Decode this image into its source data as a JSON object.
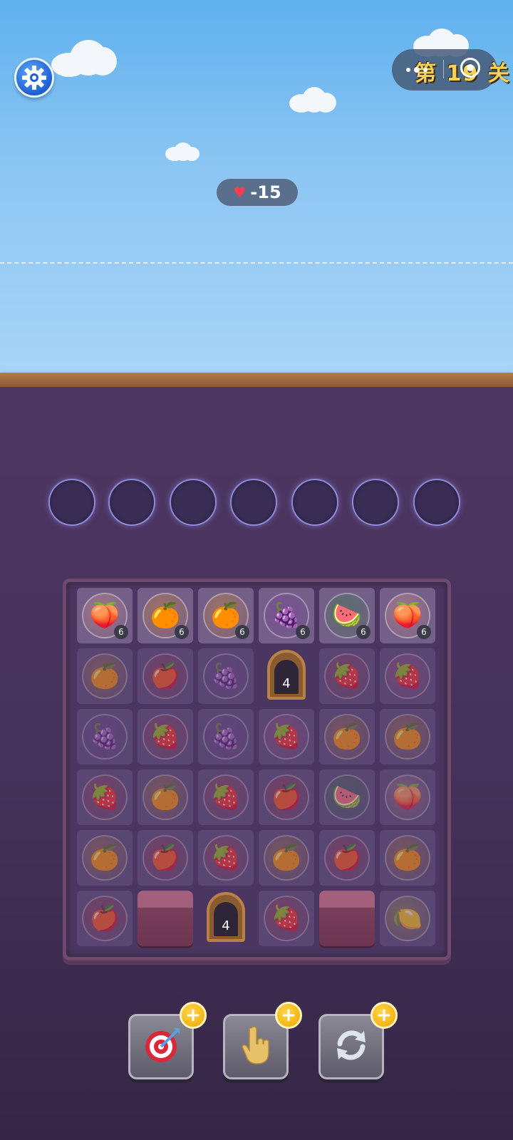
{
  "header": {
    "level_label": "第 19 关",
    "lives_value": "-15",
    "heart_icon": "heart-icon"
  },
  "slots_count": 7,
  "board": {
    "rows": [
      [
        {
          "fruit": "peach",
          "count": "6"
        },
        {
          "fruit": "orange",
          "count": "6"
        },
        {
          "fruit": "orange",
          "count": "6"
        },
        {
          "fruit": "grape",
          "count": "6"
        },
        {
          "fruit": "watermelon",
          "count": "6"
        },
        {
          "fruit": "peach",
          "count": "6"
        }
      ],
      [
        {
          "fruit": "orange"
        },
        {
          "fruit": "apple"
        },
        {
          "fruit": "grape"
        },
        {
          "door": "4"
        },
        {
          "fruit": "strawberry"
        },
        {
          "fruit": "dragonfruit"
        }
      ],
      [
        {
          "fruit": "grape"
        },
        {
          "fruit": "strawberry"
        },
        {
          "fruit": "grape"
        },
        {
          "fruit": "dragonfruit"
        },
        {
          "fruit": "orange"
        },
        {
          "fruit": "orange"
        }
      ],
      [
        {
          "fruit": "strawberry"
        },
        {
          "fruit": "orange"
        },
        {
          "fruit": "strawberry"
        },
        {
          "fruit": "apple"
        },
        {
          "fruit": "watermelon"
        },
        {
          "fruit": "peach"
        }
      ],
      [
        {
          "fruit": "orange"
        },
        {
          "fruit": "apple"
        },
        {
          "fruit": "strawberry"
        },
        {
          "fruit": "orange"
        },
        {
          "fruit": "apple"
        },
        {
          "fruit": "orange"
        }
      ],
      [
        {
          "fruit": "apple"
        },
        {
          "block": true
        },
        {
          "door": "4"
        },
        {
          "fruit": "strawberry"
        },
        {
          "block": true
        },
        {
          "fruit": "lemon"
        }
      ]
    ]
  },
  "tools": [
    {
      "name": "target-tool",
      "icon": "target-icon",
      "plus": "+"
    },
    {
      "name": "hand-tool",
      "icon": "hand-icon",
      "plus": "+"
    },
    {
      "name": "shuffle-tool",
      "icon": "refresh-icon",
      "plus": "+"
    }
  ],
  "colors": {
    "peach": "#f5a58c",
    "orange": "#f39a24",
    "grape": "#7a3aa0",
    "watermelon": "#2f8a3a",
    "apple": "#d9283a",
    "strawberry": "#d8303f",
    "dragonfruit": "#e0508a",
    "lemon": "#e8cf2a"
  }
}
